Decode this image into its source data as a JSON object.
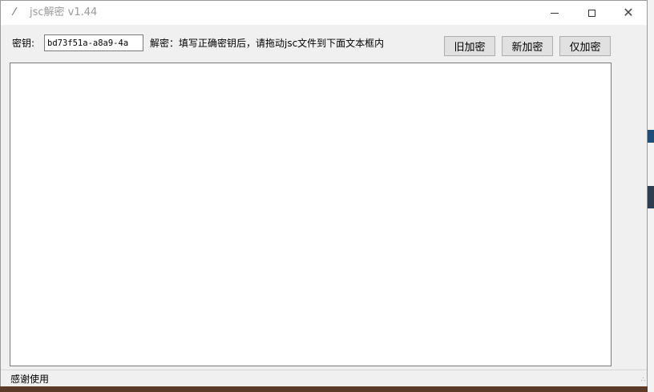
{
  "window": {
    "title": "jsc解密 v1.44"
  },
  "toolbar": {
    "key_label": "密钥:",
    "key_value": "bd73f51a-a8a9-4a",
    "hint": "解密：填写正确密钥后，请拖动jsc文件到下面文本框内",
    "buttons": {
      "old_encrypt": "旧加密",
      "new_encrypt": "新加密",
      "only_encrypt": "仅加密"
    }
  },
  "drop_area": {
    "value": ""
  },
  "status": {
    "text": "感谢使用"
  }
}
